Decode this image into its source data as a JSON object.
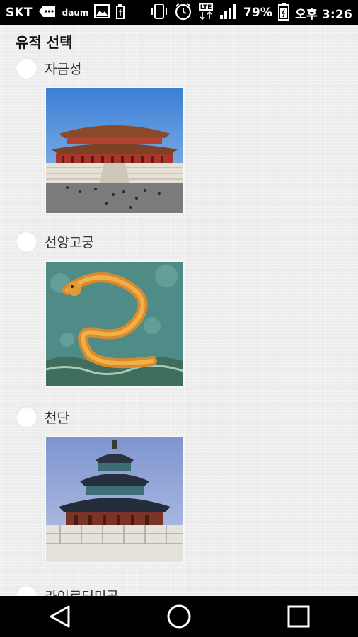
{
  "status_bar": {
    "carrier": "SKT",
    "app_badge": "daum",
    "network": "LTE",
    "battery": "79%",
    "time": "오후 3:26"
  },
  "page": {
    "section_title": "유적 선택",
    "options": [
      {
        "label": "자금성",
        "image": "forbidden-city-hall"
      },
      {
        "label": "선양고궁",
        "image": "dragon-relief-wall"
      },
      {
        "label": "천단",
        "image": "temple-of-heaven"
      },
      {
        "label": "카이로터미곳",
        "image": "partially-hidden"
      }
    ]
  },
  "nav_bar": {
    "icons": [
      "back-icon",
      "home-icon",
      "recents-icon"
    ]
  },
  "colors": {
    "status_bar_bg": "#000000",
    "content_bg": "#ececec",
    "nav_bar_bg": "#000000"
  }
}
